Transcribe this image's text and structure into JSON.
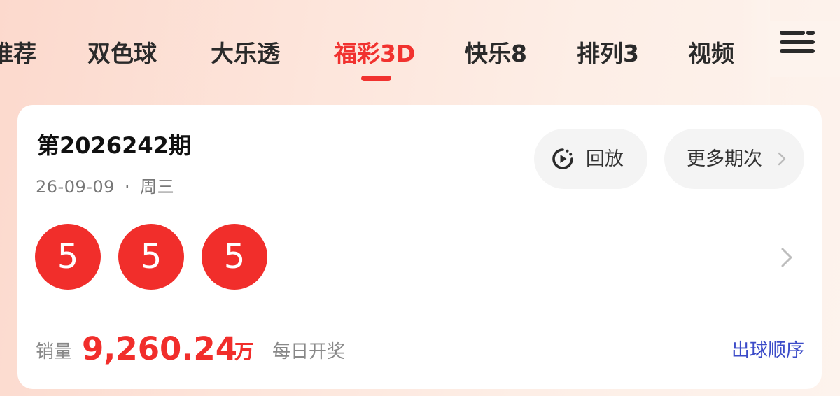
{
  "tabs": [
    {
      "label": "推荐",
      "active": false
    },
    {
      "label": "双色球",
      "active": false
    },
    {
      "label": "大乐透",
      "active": false
    },
    {
      "label": "福彩3D",
      "active": true
    },
    {
      "label": "快乐8",
      "active": false
    },
    {
      "label": "排列3",
      "active": false
    },
    {
      "label": "视频",
      "active": false
    }
  ],
  "menu_icon": "hamburger-menu-icon",
  "card": {
    "issue": "第2026242期",
    "date": "26-09-09",
    "separator": "·",
    "weekday": "周三",
    "replay_label": "回放",
    "replay_icon": "replay-icon",
    "more_label": "更多期次",
    "balls": [
      "5",
      "5",
      "5"
    ],
    "sales_label": "销量",
    "sales_value": "9,260.24",
    "sales_unit": "万",
    "draw_frequency": "每日开奖",
    "order_link": "出球顺序"
  },
  "colors": {
    "accent_red": "#f12e2b",
    "link_blue": "#3b4bc8",
    "text_dark": "#2a2a2a"
  }
}
